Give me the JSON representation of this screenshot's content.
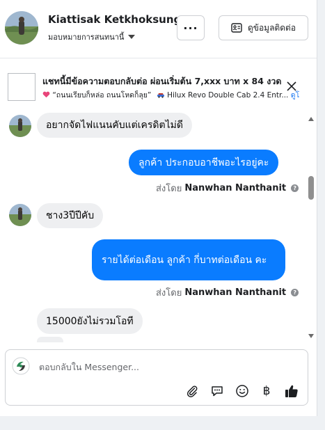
{
  "header": {
    "name": "Kiattisak Ketkhoksung",
    "assignee": "มอบหมายการสนทนานี้",
    "more_label": "···",
    "contact_label": "ดูข้อมูลติดต่อ"
  },
  "ad_context": {
    "title": "แชทนี้มีข้อความตอบกลับต่อ ผ่อนเริ่มต้น 7,xxx บาท x 84 งวด",
    "quote": "“ถนนเรียบก็หล่อ ถนนโหดก็ลุย”",
    "product": "Hilux Revo Double Cab 2.4 Entr...",
    "link": "ดูโ"
  },
  "messages": [
    {
      "dir": "in",
      "text": "อยากจัดไฟแนนคับแต่เครดิตไม่ดี"
    },
    {
      "dir": "out",
      "text": "ลูกค้า ประกอบอาชีพอะไรอยู่คะ"
    },
    {
      "dir": "in",
      "text": "ชาง3ปีปีคับ"
    },
    {
      "dir": "out",
      "text": "รายได้ต่อเดือน  ลูกค้า   กี่บาทต่อเดือน คะ"
    },
    {
      "dir": "in",
      "text": "15000ยังไม่รวมโอที"
    }
  ],
  "sent_by": {
    "prefix": "ส่งโดย",
    "agent": "Nanwhan Nanthanit"
  },
  "composer": {
    "placeholder": "ตอบกลับใน Messenger...",
    "baht_symbol": "฿"
  },
  "colors": {
    "accent": "#0a7cff",
    "incoming_bubble": "#eeeff1",
    "link": "#1877f2"
  },
  "icons": [
    "more-icon",
    "contact-card-icon",
    "close-icon",
    "attach-icon",
    "saved-reply-icon",
    "emoji-icon",
    "baht-icon",
    "thumbs-up-icon"
  ]
}
